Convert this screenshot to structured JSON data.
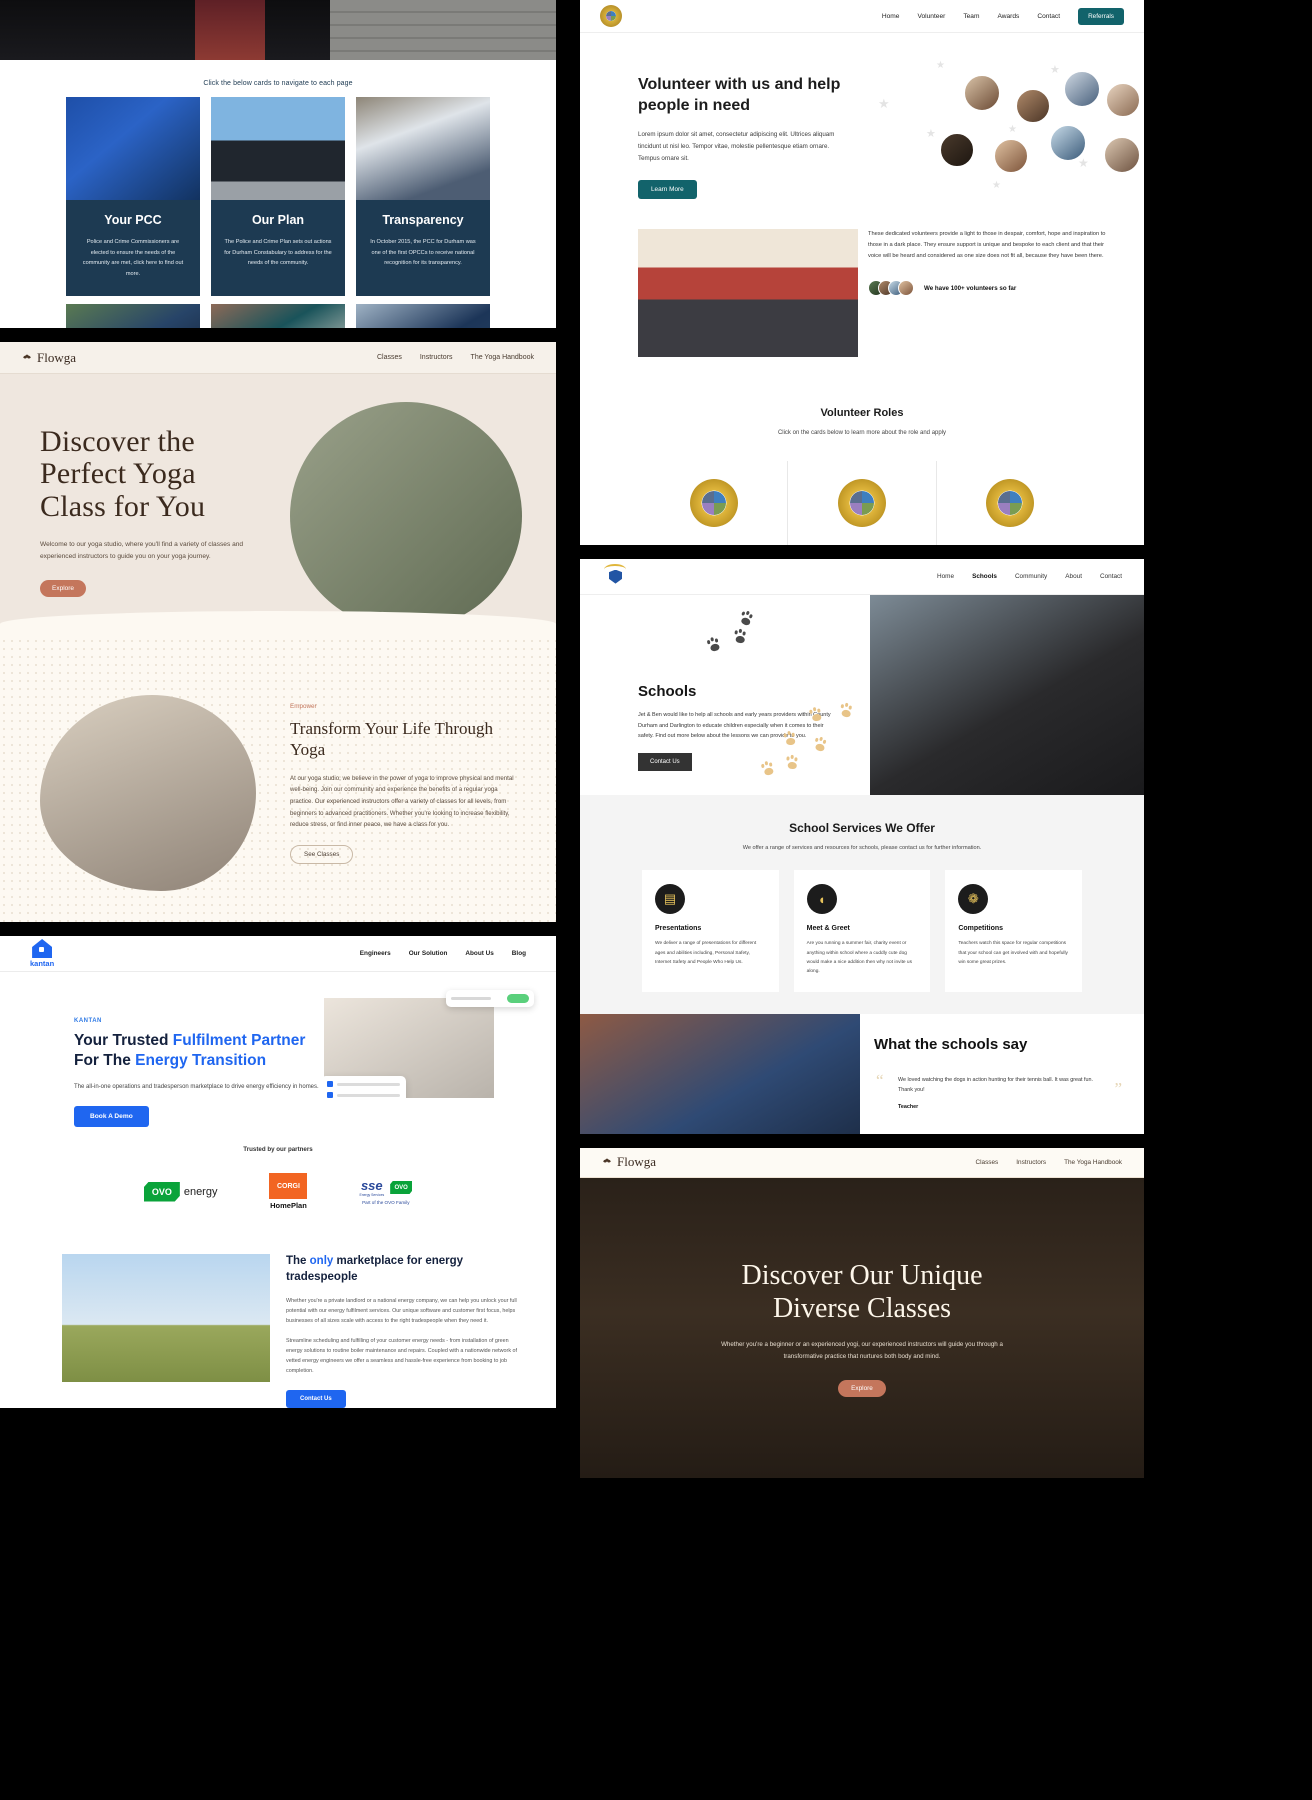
{
  "pcc": {
    "caption": "Click the below cards to navigate to each page",
    "cards": [
      {
        "title": "Your PCC",
        "body": "Police and Crime Commissioners are elected to ensure the needs of the community are met, click here to find out more."
      },
      {
        "title": "Our Plan",
        "body": "The Police and Crime Plan sets out actions for Durham Constabulary to address for the needs of the community."
      },
      {
        "title": "Transparency",
        "body": "In October 2015, the PCC for Durham was one of the first OPCCs to receive national recognition for its transparency."
      }
    ]
  },
  "flowga": {
    "brand": "Flowga",
    "nav": [
      "Classes",
      "Instructors",
      "The Yoga Handbook"
    ],
    "hero": {
      "title_line1": "Discover the",
      "title_highlight": "Perfect",
      "title_line2_rest": "Yoga",
      "title_line3": "Class for You",
      "body": "Welcome to our yoga studio, where you'll find a variety of classes and experienced instructors to guide you on your yoga journey.",
      "cta": "Explore"
    },
    "transform": {
      "kicker": "Empower",
      "title": "Transform Your Life Through Yoga",
      "body": "At our yoga studio, we believe in the power of yoga to improve physical and mental well-being. Join our community and experience the benefits of a regular yoga practice. Our experienced instructors offer a variety of classes for all levels, from beginners to advanced practitioners. Whether you're looking to increase flexibility, reduce stress, or find inner peace, we have a class for you.",
      "cta": "See Classes"
    }
  },
  "kantan": {
    "brand": "kantan",
    "nav": [
      "Engineers",
      "Our Solution",
      "About Us",
      "Blog"
    ],
    "hero": {
      "kicker": "KANTAN",
      "title_a": "Your Trusted ",
      "title_b": "Fulfilment Partner",
      "title_c": "For The ",
      "title_d": "Energy Transition",
      "body": "The all-in-one operations and tradesperson marketplace to drive energy efficiency in homes.",
      "cta": "Book A Demo"
    },
    "partners": {
      "label": "Trusted by our partners",
      "logos": [
        {
          "name": "OVO energy",
          "mark": "OVO",
          "word": "energy"
        },
        {
          "name": "CORGI HomePlan",
          "mark": "CORGI",
          "word": "HomePlan"
        },
        {
          "name": "SSE Energy Services",
          "mark": "sse",
          "sub": "Energy Services",
          "word": "Part of the OVO Family",
          "ovo": "OVO"
        }
      ]
    },
    "market": {
      "title_a": "The ",
      "title_b": "only",
      "title_c": " marketplace for energy tradespeople",
      "p1": "Whether you're a private landlord or a national energy company, we can help you unlock your full potential with our energy fulfilment services. Our unique software and customer first focus, helps businesses of all sizes scale with access to the right tradespeople when they need it.",
      "p2": "Streamline scheduling and fulfilling of your customer energy needs - from installation of green energy solutions to routine boiler maintenance and repairs. Coupled with a nationwide network of vetted energy engineers we offer a seamless and hassle-free experience from booking to job completion.",
      "cta": "Contact Us"
    }
  },
  "volunteer": {
    "nav": [
      "Home",
      "Volunteer",
      "Team",
      "Awards",
      "Contact"
    ],
    "nav_cta": "Referrals",
    "hero": {
      "title": "Volunteer with us and help people in need",
      "body": "Lorem ipsum dolor sit amet, consectetur adipiscing elit. Ultrices aliquam tincidunt ut nisl leo. Tempor vitae, molestie pellentesque etiam ornare. Tempus ornare sit.",
      "cta": "Learn More"
    },
    "mid": {
      "body": "These dedicated volunteers provide a light to those in despair, comfort, hope and inspiration to those in a dark place. They ensure support is unique and bespoke to each client and that their voice will be heard and considered as one size does not fit all, because they have been there.",
      "count": "We have 100+ volunteers so far"
    },
    "roles": {
      "title": "Volunteer Roles",
      "sub": "Click on the cards below to learn more about the role and apply"
    }
  },
  "schools": {
    "nav": [
      "Home",
      "Schools",
      "Community",
      "About",
      "Contact"
    ],
    "active_nav": "Schools",
    "hero": {
      "title": "Schools",
      "body": "Jet & Ben would like to help all schools and early years providers within County Durham and Darlington to educate children especially when it comes to their safety. Find out more below about the lessons we can provide to you.",
      "cta": "Contact Us"
    },
    "services": {
      "title": "School Services We Offer",
      "sub": "We offer a range of services and resources for schools, please contact us for further information.",
      "items": [
        {
          "icon": "presentation-icon",
          "glyph": "▤",
          "title": "Presentations",
          "body": "We deliver a range of presentations for different ages and abilities including, Personal Safety, Internet Safety and People Who Help Us."
        },
        {
          "icon": "dog-icon",
          "glyph": "◖",
          "title": "Meet & Greet",
          "body": "Are you running a summer fair, charity event or anything within school where a cuddly cute dog would make a nice addition then why not invite us along."
        },
        {
          "icon": "award-icon",
          "glyph": "❁",
          "title": "Competitions",
          "body": "Teachers watch this space for regular competitions that your school can get involved with and hopefully win some great prizes."
        }
      ]
    },
    "say": {
      "title": "What the schools say",
      "quote": "We loved watching the dogs in action hunting for their tennis ball. It was great fun. Thank you!",
      "who": "Teacher"
    }
  },
  "flowga_dark": {
    "brand": "Flowga",
    "nav": [
      "Classes",
      "Instructors",
      "The Yoga Handbook"
    ],
    "title_line1": "Discover Our Unique",
    "title_line2": "Diverse Classes",
    "body": "Whether you're a beginner or an experienced yogi, our experienced instructors will guide you through a transformative practice that nurtures both body and mind.",
    "cta": "Explore"
  },
  "colors": {
    "pcc_navy": "#1d3a52",
    "flowga_terracotta": "#c4765c",
    "kantan_blue": "#1f66f0",
    "volunteer_teal": "#12636b",
    "schools_dark": "#333333"
  }
}
